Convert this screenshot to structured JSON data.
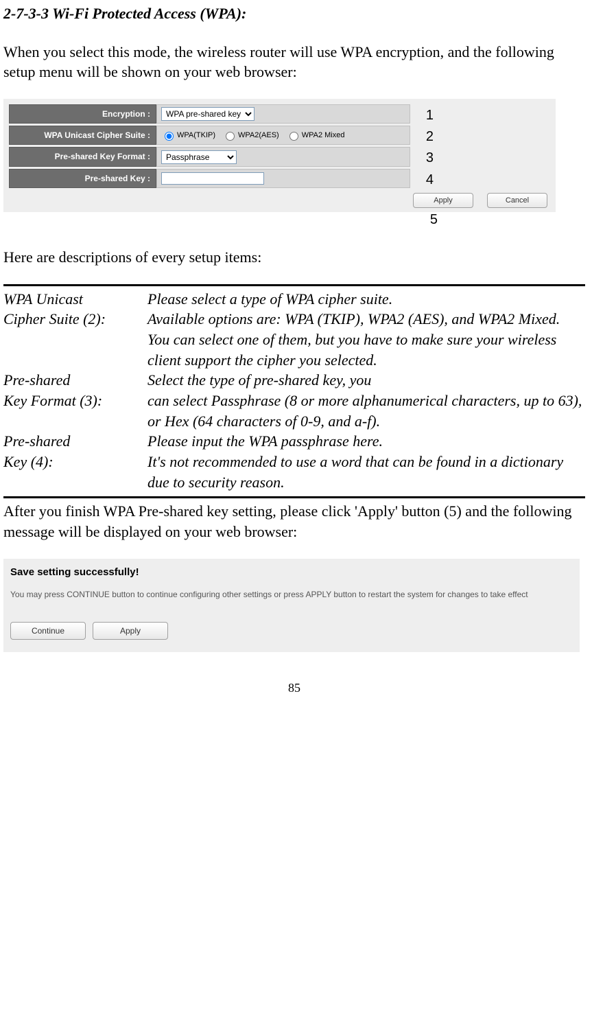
{
  "section_title": "2-7-3-3 Wi-Fi Protected Access (WPA):",
  "intro": "When you select this mode, the wireless router will use WPA encryption, and the following setup menu will be shown on your web browser:",
  "config": {
    "rows": [
      {
        "label": "Encryption :",
        "type": "select",
        "value": "WPA pre-shared key",
        "annot": "1"
      },
      {
        "label": "WPA Unicast Cipher Suite :",
        "type": "radio",
        "options": [
          "WPA(TKIP)",
          "WPA2(AES)",
          "WPA2 Mixed"
        ],
        "selected": 0,
        "annot": "2"
      },
      {
        "label": "Pre-shared Key Format :",
        "type": "select",
        "value": "Passphrase",
        "annot": "3"
      },
      {
        "label": "Pre-shared Key :",
        "type": "password",
        "value": "",
        "annot": "4"
      }
    ],
    "buttons": {
      "apply": "Apply",
      "cancel": "Cancel",
      "annot": "5"
    }
  },
  "mid": "Here are descriptions of every setup items:",
  "desc": [
    {
      "left1": "WPA Unicast",
      "left2": "Cipher Suite (2):",
      "right1": "Please select a type of WPA cipher suite.",
      "rightRest": "Available options are: WPA (TKIP), WPA2 (AES), and WPA2 Mixed. You can select one of them, but you have to make sure your wireless client support the cipher you selected."
    },
    {
      "left1": "Pre-shared",
      "left2": "Key Format (3):",
      "right1": "Select the type of pre-shared key, you",
      "rightRest": "can select Passphrase (8 or more alphanumerical characters, up to 63), or Hex (64 characters of 0-9, and a-f)."
    },
    {
      "left1": "Pre-shared",
      "left2": "Key (4):",
      "right1": "Please input the WPA passphrase here.",
      "rightRest": "It's not recommended to use a word that can be found in a dictionary due to security reason."
    }
  ],
  "after": "After you finish WPA Pre-shared key setting, please click 'Apply' button (5) and the following message will be displayed on your web browser:",
  "save": {
    "title": "Save setting successfully!",
    "msg": "You may press CONTINUE button to continue configuring other settings or press APPLY button to restart the system for changes to take effect",
    "continue": "Continue",
    "apply": "Apply"
  },
  "page_num": "85"
}
